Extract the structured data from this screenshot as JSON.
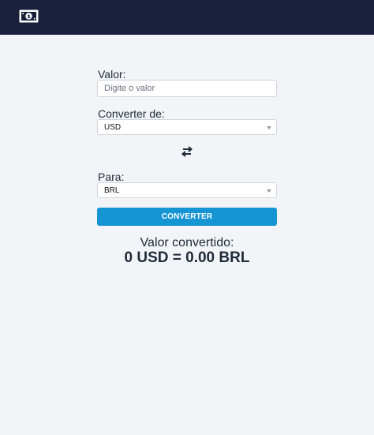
{
  "header": {
    "logo_icon": "money-bill-icon",
    "background": "#1a1f3c"
  },
  "form": {
    "amount_label": "Valor:",
    "amount_placeholder": "Digite o valor",
    "amount_value": "",
    "from_label": "Converter de:",
    "from_value": "USD",
    "swap_icon": "swap-arrows-icon",
    "to_label": "Para:",
    "to_value": "BRL",
    "convert_button_label": "CONVERTER",
    "accent_color": "#1595d3"
  },
  "result": {
    "label": "Valor convertido:",
    "value": "0 USD = 0.00 BRL"
  }
}
